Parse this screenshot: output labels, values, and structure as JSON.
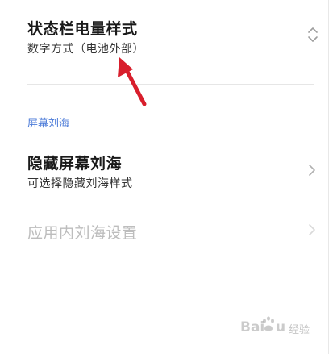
{
  "status_bar_battery_style": {
    "title": "状态栏电量样式",
    "value": "数字方式（电池外部）",
    "icon": "chevron-up-down-icon"
  },
  "section_notch": {
    "header": "屏幕刘海"
  },
  "hide_notch": {
    "title": "隐藏屏幕刘海",
    "subtitle": "可选择隐藏刘海样式",
    "icon": "chevron-right-icon"
  },
  "in_app_notch": {
    "title": "应用内刘海设置",
    "icon": "chevron-right-icon",
    "enabled": false
  },
  "annotation": {
    "type": "arrow",
    "color": "#d81e2c"
  },
  "watermark": {
    "logo_text": "Bai",
    "logo_text_end": "u",
    "suffix": "经验"
  },
  "colors": {
    "accent": "#4c7bd8",
    "title": "#1a1a1a",
    "disabled": "#bdbdbd",
    "arrow": "#d81e2c"
  }
}
